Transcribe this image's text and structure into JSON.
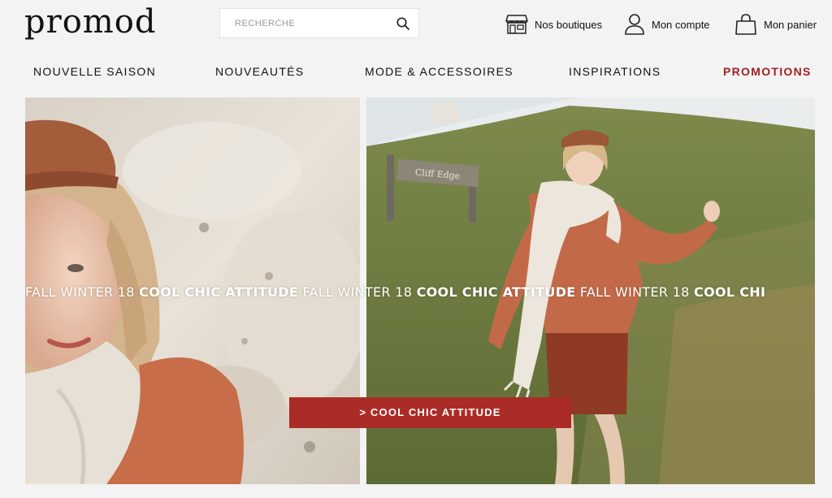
{
  "header": {
    "logo": "promod",
    "search": {
      "placeholder": "RECHERCHE",
      "value": ""
    },
    "stores_label": "Nos boutiques",
    "account_label": "Mon compte",
    "cart_label": "Mon panier"
  },
  "nav": {
    "items": [
      {
        "label": "NOUVELLE SAISON"
      },
      {
        "label": "NOUVEAUTÉS"
      },
      {
        "label": "MODE & ACCESSOIRES"
      },
      {
        "label": "INSPIRATIONS"
      },
      {
        "label": "PROMOTIONS"
      }
    ],
    "promo_color": "#a51e22"
  },
  "hero": {
    "marquee": [
      {
        "light": "FALL WINTER 18 ",
        "bold": "COOL CHIC ATTITUDE"
      },
      {
        "light": " FALL WINTER 18 ",
        "bold": "COOL CHIC ATTITUDE"
      },
      {
        "light": " FALL WINTER 18 ",
        "bold": "COOL CHI"
      }
    ],
    "cta_label": "> COOL CHIC ATTITUDE",
    "cta_color": "#ab2c27",
    "sign_text": "Cliff Edge"
  }
}
